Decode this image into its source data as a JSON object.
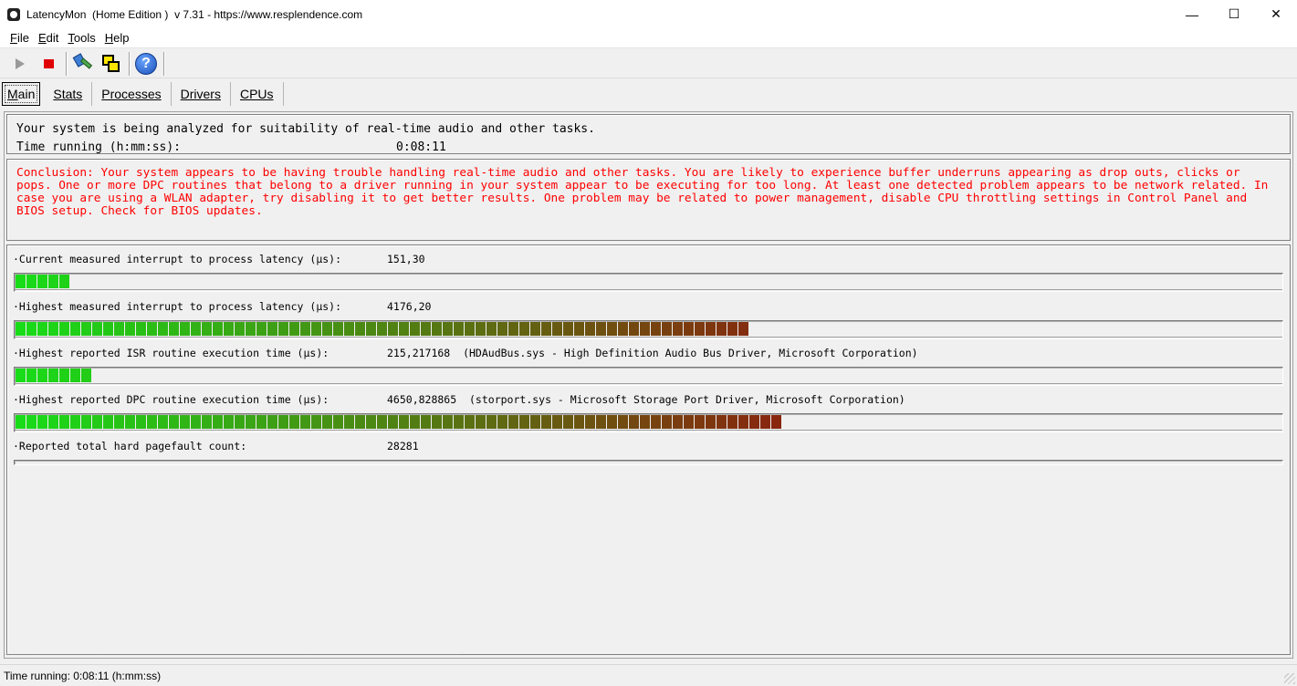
{
  "window": {
    "title": "LatencyMon  (Home Edition )  v 7.31 - https://www.resplendence.com",
    "minimize_glyph": "—",
    "maximize_glyph": "☐",
    "close_glyph": "✕"
  },
  "menu": [
    {
      "mnemonic": "F",
      "rest": "ile"
    },
    {
      "mnemonic": "E",
      "rest": "dit"
    },
    {
      "mnemonic": "T",
      "rest": "ools"
    },
    {
      "mnemonic": "H",
      "rest": "elp"
    }
  ],
  "toolbar": {
    "buttons": [
      {
        "name": "start",
        "icon": "play-icon"
      },
      {
        "name": "stop",
        "icon": "stop-icon"
      },
      {
        "name": "tools",
        "icon": "tools-icon"
      },
      {
        "name": "windows",
        "icon": "windows-icon"
      },
      {
        "name": "help",
        "icon": "help-icon",
        "glyph": "?"
      }
    ]
  },
  "tabs": [
    {
      "label": "Main",
      "active": true
    },
    {
      "label": "Stats"
    },
    {
      "label": "Processes"
    },
    {
      "label": "Drivers"
    },
    {
      "label": "CPUs"
    }
  ],
  "summary": {
    "line1": "Your system is being analyzed for suitability of real-time audio and other tasks.",
    "time_label": "Time running (h:mm:ss):",
    "time_value": "0:08:11"
  },
  "conclusion": "Conclusion: Your system appears to be having trouble handling real-time audio and other tasks. You are likely to experience buffer underruns appearing as drop outs, clicks or pops. One or more DPC routines that belong to a driver running in your system appear to be executing for too long. At least one detected problem appears to be network related. In case you are using a WLAN adapter, try disabling it to get better results. One problem may be related to power management, disable CPU throttling settings in Control Panel and BIOS setup. Check for BIOS updates.",
  "metrics": [
    {
      "label": "·Current measured interrupt to process latency (µs):",
      "value": "151,30",
      "segments_fraction": 0.046
    },
    {
      "label": "·Highest measured interrupt to process latency (µs):",
      "value": "4176,20",
      "segments_fraction": 0.585
    },
    {
      "label": "·Highest reported ISR routine execution time (µs):",
      "value": "215,217168  (HDAudBus.sys - High Definition Audio Bus Driver, Microsoft Corporation)",
      "segments_fraction": 0.059
    },
    {
      "label": "·Highest reported DPC routine execution time (µs):",
      "value": "4650,828865  (storport.sys - Microsoft Storage Port Driver, Microsoft Corporation)",
      "segments_fraction": 0.611
    },
    {
      "label": "·Reported total hard pagefault count:",
      "value": "28281",
      "segments_fraction": 0
    }
  ],
  "status": "Time running: 0:08:11  (h:mm:ss)"
}
